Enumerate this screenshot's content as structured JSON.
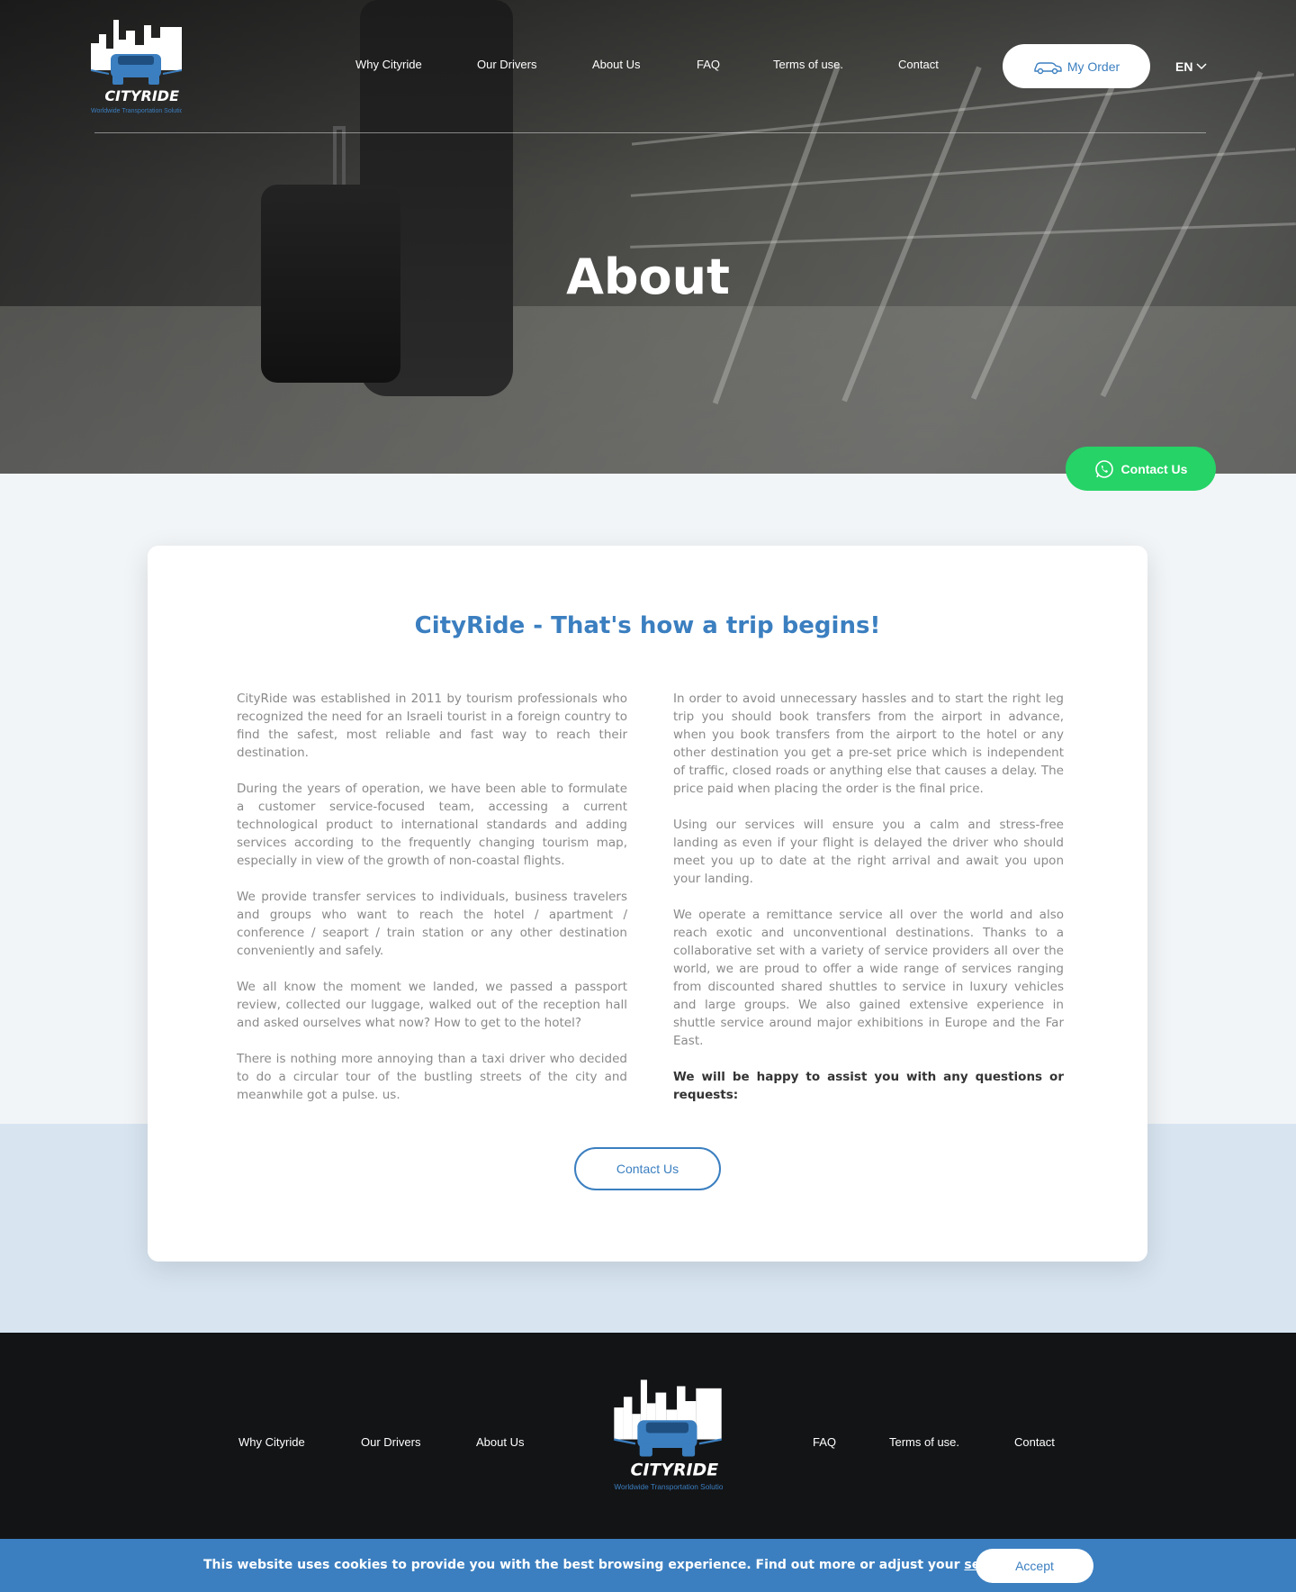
{
  "brand": {
    "name": "CITYRIDE",
    "tagline": "Worldwide Transportation Solutions",
    "accent_color": "#3b7fc0",
    "whatsapp_color": "#25d366"
  },
  "nav": {
    "items": [
      "Why Cityride",
      "Our Drivers",
      "About Us",
      "FAQ",
      "Terms of use.",
      "Contact"
    ],
    "my_order_label": "My Order",
    "language": "EN"
  },
  "hero": {
    "title": "About"
  },
  "whatsapp_button": {
    "label": "Contact Us",
    "icon": "whatsapp-icon"
  },
  "content": {
    "heading": "CityRide - That's how a trip begins!",
    "left_paragraphs": [
      "CityRide was established in 2011 by tourism professionals who recognized the need for an Israeli tourist in a foreign country to find the safest, most reliable and fast way to reach their destination.",
      "During the years of operation, we have been able to formulate a customer service-focused team, accessing a current technological product to international standards and adding services according to the frequently changing tourism map, especially in view of the growth of non-coastal flights.",
      "We provide transfer services to individuals, business travelers and groups who want to reach the hotel / apartment / conference / seaport / train station or any other destination conveniently and safely.",
      "We all know the moment we landed, we passed a passport review, collected our luggage, walked out of the reception hall and asked ourselves what now? How to get to the hotel?",
      "There is nothing more annoying than a taxi driver who decided to do a circular tour of the bustling streets of the city and meanwhile got a pulse. us."
    ],
    "right_paragraphs": [
      "In order to avoid unnecessary hassles and to start the right leg trip you should book transfers from the airport in advance, when you book transfers from the airport to the hotel or any other destination you get a pre-set price which is independent of traffic, closed roads or anything else that causes a delay. The price paid when placing the order is the final price.",
      "Using our services will ensure you a calm and stress-free landing as even if your flight is delayed the driver who should meet you up to date at the right arrival and await you upon your landing.",
      "We operate a remittance service all over the world and also reach exotic and unconventional destinations. Thanks to a collaborative set with a variety of service providers all over the world, we are proud to offer a wide range of services ranging from discounted shared shuttles to service in luxury vehicles and large groups. We also gained extensive experience in shuttle service around major exhibitions in Europe and the Far East."
    ],
    "closing_bold": "We will be happy to assist you with any questions or requests:",
    "contact_button_label": "Contact Us"
  },
  "footer": {
    "left_links": [
      "Why Cityride",
      "Our Drivers",
      "About Us"
    ],
    "right_links": [
      "FAQ",
      "Terms of use.",
      "Contact"
    ]
  },
  "cookie_bar": {
    "text": "This website uses cookies to provide you with the best browsing experience. Find out more or adjust your",
    "settings_link": "settings.",
    "accept_label": "Accept"
  }
}
